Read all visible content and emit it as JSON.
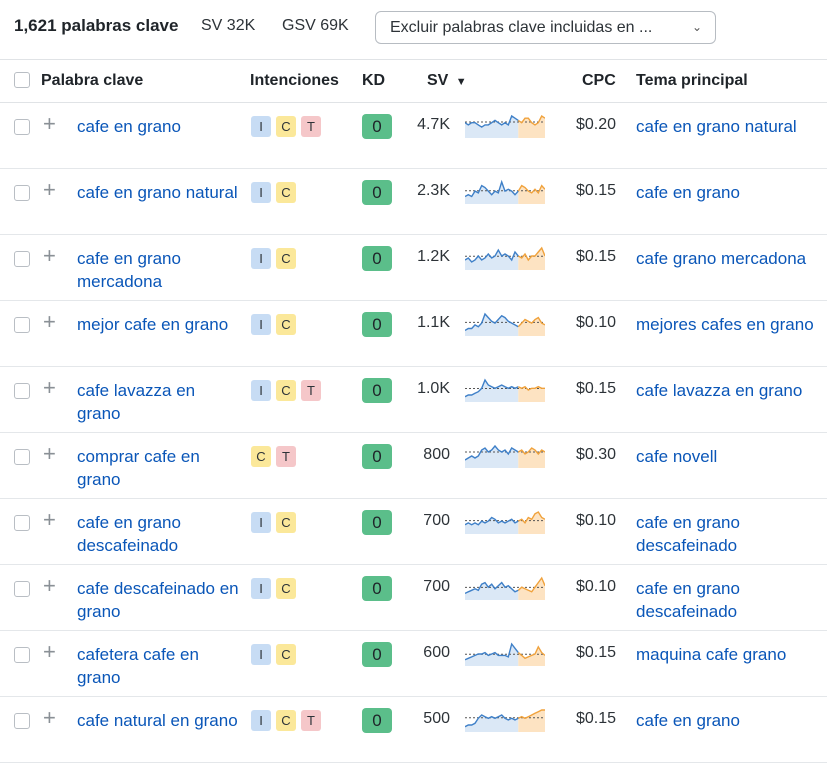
{
  "summary": {
    "keyword_count": "1,621 palabras clave",
    "sv": "SV 32K",
    "gsv": "GSV 69K",
    "exclude_select": "Excluir palabras clave incluidas en ..."
  },
  "columns": {
    "keyword": "Palabra clave",
    "intents": "Intenciones",
    "kd": "KD",
    "sv": "SV",
    "cpc": "CPC",
    "topic": "Tema principal"
  },
  "rows": [
    {
      "keyword": "cafe en grano",
      "intents": [
        "I",
        "C",
        "T"
      ],
      "kd": "0",
      "sv": "4.7K",
      "cpc": "$0.20",
      "topic": "cafe en grano natural",
      "trend": [
        6,
        5,
        6,
        6,
        5,
        4,
        5,
        5,
        6,
        7,
        6,
        5,
        6,
        5,
        9,
        8,
        7,
        6,
        8,
        8,
        6,
        5,
        6,
        9,
        8
      ]
    },
    {
      "keyword": "cafe en grano natural",
      "intents": [
        "I",
        "C"
      ],
      "kd": "0",
      "sv": "2.3K",
      "cpc": "$0.15",
      "topic": "cafe en grano",
      "trend": [
        3,
        4,
        3,
        6,
        5,
        9,
        8,
        6,
        4,
        6,
        5,
        11,
        6,
        7,
        6,
        4,
        6,
        9,
        8,
        6,
        5,
        7,
        5,
        9,
        7
      ]
    },
    {
      "keyword": "cafe en grano mercadona",
      "intents": [
        "I",
        "C"
      ],
      "kd": "0",
      "sv": "1.2K",
      "cpc": "$0.15",
      "topic": "cafe grano mercadona",
      "trend": [
        4,
        5,
        3,
        4,
        6,
        4,
        5,
        7,
        5,
        6,
        9,
        6,
        7,
        6,
        4,
        8,
        6,
        5,
        7,
        4,
        6,
        6,
        8,
        10,
        6
      ]
    },
    {
      "keyword": "mejor cafe en grano",
      "intents": [
        "I",
        "C"
      ],
      "kd": "0",
      "sv": "1.1K",
      "cpc": "$0.10",
      "topic": "mejores cafes en grano",
      "trend": [
        2,
        3,
        3,
        5,
        4,
        6,
        11,
        9,
        7,
        6,
        8,
        10,
        9,
        7,
        6,
        5,
        4,
        6,
        8,
        7,
        6,
        8,
        9,
        6,
        5
      ]
    },
    {
      "keyword": "cafe lavazza en grano",
      "intents": [
        "I",
        "C",
        "T"
      ],
      "kd": "0",
      "sv": "1.0K",
      "cpc": "$0.15",
      "topic": "cafe lavazza en grano",
      "trend": [
        2,
        3,
        3,
        4,
        5,
        7,
        12,
        9,
        8,
        7,
        8,
        9,
        8,
        7,
        8,
        7,
        8,
        7,
        8,
        6,
        7,
        7,
        8,
        7,
        7
      ]
    },
    {
      "keyword": "comprar cafe en grano",
      "intents": [
        "C",
        "T"
      ],
      "kd": "0",
      "sv": "800",
      "cpc": "$0.30",
      "topic": "cafe novell",
      "trend": [
        3,
        4,
        5,
        4,
        5,
        8,
        9,
        7,
        8,
        10,
        8,
        7,
        8,
        6,
        9,
        8,
        7,
        8,
        6,
        7,
        9,
        8,
        6,
        8,
        7
      ]
    },
    {
      "keyword": "cafe en grano descafeinado",
      "intents": [
        "I",
        "C"
      ],
      "kd": "0",
      "sv": "700",
      "cpc": "$0.10",
      "topic": "cafe en grano descafeinado",
      "trend": [
        4,
        5,
        4,
        5,
        4,
        6,
        5,
        6,
        8,
        7,
        5,
        6,
        5,
        6,
        7,
        5,
        6,
        7,
        5,
        8,
        7,
        10,
        11,
        8,
        7
      ]
    },
    {
      "keyword": "cafe descafeinado en grano",
      "intents": [
        "I",
        "C"
      ],
      "kd": "0",
      "sv": "700",
      "cpc": "$0.10",
      "topic": "cafe en grano descafeinado",
      "trend": [
        3,
        4,
        5,
        6,
        5,
        9,
        10,
        7,
        9,
        6,
        8,
        10,
        7,
        8,
        6,
        4,
        5,
        7,
        6,
        5,
        4,
        7,
        10,
        13,
        8
      ]
    },
    {
      "keyword": "cafetera cafe en grano",
      "intents": [
        "I",
        "C"
      ],
      "kd": "0",
      "sv": "600",
      "cpc": "$0.15",
      "topic": "maquina cafe grano",
      "trend": [
        3,
        4,
        5,
        6,
        7,
        7,
        8,
        6,
        7,
        8,
        6,
        6,
        6,
        5,
        14,
        11,
        8,
        6,
        4,
        5,
        6,
        7,
        12,
        8,
        6
      ]
    },
    {
      "keyword": "cafe natural en grano",
      "intents": [
        "I",
        "C",
        "T"
      ],
      "kd": "0",
      "sv": "500",
      "cpc": "$0.15",
      "topic": "cafe en grano",
      "trend": [
        2,
        3,
        3,
        4,
        7,
        9,
        8,
        7,
        8,
        7,
        8,
        9,
        7,
        6,
        7,
        6,
        7,
        8,
        7,
        8,
        9,
        10,
        11,
        12,
        12
      ]
    }
  ],
  "colors": {
    "link": "#0a56b8",
    "kd_easy": "#5bbe8a",
    "intent_I": "#c7dcf4",
    "intent_C": "#fbe89a",
    "intent_T": "#f5c7c9",
    "trend_blue": "#3f80c8",
    "trend_orange": "#f0a23c"
  },
  "icons": {
    "sort": "sort-desc-icon",
    "add": "plus-icon",
    "dropdown": "chevron-down-icon"
  }
}
